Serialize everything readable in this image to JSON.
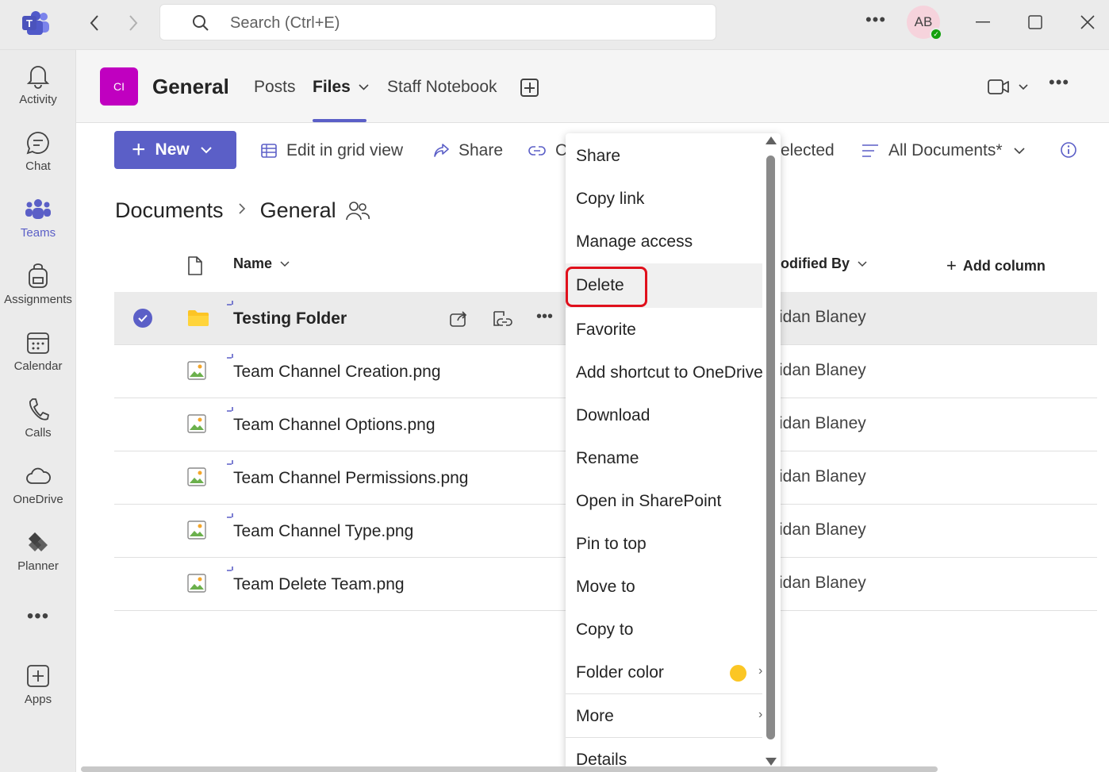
{
  "titlebar": {
    "search_placeholder": "Search (Ctrl+E)",
    "avatar_initials": "AB"
  },
  "rail": {
    "items": [
      {
        "label": "Activity"
      },
      {
        "label": "Chat"
      },
      {
        "label": "Teams"
      },
      {
        "label": "Assignments"
      },
      {
        "label": "Calendar"
      },
      {
        "label": "Calls"
      },
      {
        "label": "OneDrive"
      },
      {
        "label": "Planner"
      },
      {
        "label": "Apps"
      }
    ],
    "more": "•••"
  },
  "header": {
    "team_initials": "CI",
    "channel": "General",
    "tabs": [
      "Posts",
      "Files",
      "Staff Notebook"
    ],
    "active_tab": "Files"
  },
  "commands": {
    "new": "New",
    "edit_grid": "Edit in grid view",
    "share": "Share",
    "copy_link_partial": "C",
    "selected_partial": "elected",
    "view": "All Documents*"
  },
  "breadcrumb": {
    "root": "Documents",
    "current": "General"
  },
  "columns": {
    "name": "Name",
    "modified_by_partial": "odified By",
    "add_column": "Add column"
  },
  "files": [
    {
      "name": "Testing Folder",
      "type": "folder",
      "modified_by": "idan Blaney",
      "selected": true
    },
    {
      "name": "Team Channel Creation.png",
      "type": "image",
      "modified_by": "idan Blaney"
    },
    {
      "name": "Team Channel Options.png",
      "type": "image",
      "modified_by": "idan Blaney"
    },
    {
      "name": "Team Channel Permissions.png",
      "type": "image",
      "modified_by": "idan Blaney"
    },
    {
      "name": "Team Channel Type.png",
      "type": "image",
      "modified_by": "idan Blaney"
    },
    {
      "name": "Team Delete Team.png",
      "type": "image",
      "modified_by": "idan Blaney"
    }
  ],
  "context_menu": {
    "items": [
      "Share",
      "Copy link",
      "Manage access",
      "Delete",
      "Favorite",
      "Add shortcut to OneDrive",
      "Download",
      "Rename",
      "Open in SharePoint",
      "Pin to top",
      "Move to",
      "Copy to",
      "Folder color",
      "More",
      "Details"
    ],
    "highlighted": "Delete",
    "folder_color": "#fbc624"
  },
  "colors": {
    "accent": "#5b5fc7",
    "team_avatar": "#c000c0",
    "annotation": "#e0101c"
  }
}
